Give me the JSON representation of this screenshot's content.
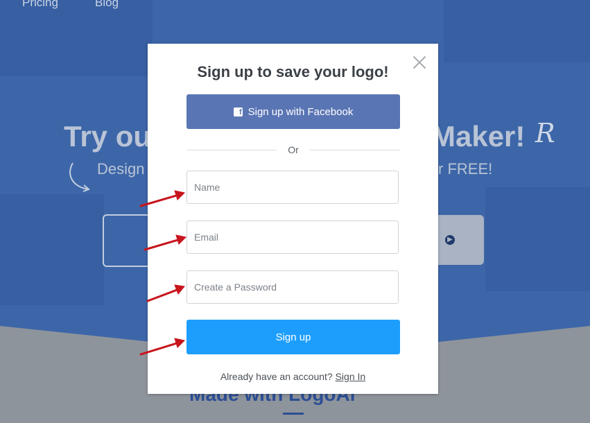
{
  "background": {
    "nav_items": [
      "Pricing",
      "Blog"
    ],
    "headline_left": "Try ou",
    "headline_right": "Maker!",
    "sub_left": "Design",
    "sub_right": "r FREE!",
    "bottom_heading": "Made with LogoAi",
    "colors": {
      "hero": "#3d66a8",
      "bottom": "#8e949b"
    }
  },
  "modal": {
    "title": "Sign up to save your logo!",
    "close_icon": "close-icon",
    "facebook_button": {
      "label": "Sign up with Facebook",
      "icon": "facebook-icon"
    },
    "divider_text": "Or",
    "fields": {
      "name_placeholder": "Name",
      "email_placeholder": "Email",
      "password_placeholder": "Create a Password"
    },
    "signup_button": "Sign up",
    "signin_prompt": "Already have an account?",
    "signin_link": "Sign In",
    "colors": {
      "facebook": "#5a75b4",
      "primary": "#1e9efc",
      "annotation_arrow": "#c8141c"
    }
  }
}
